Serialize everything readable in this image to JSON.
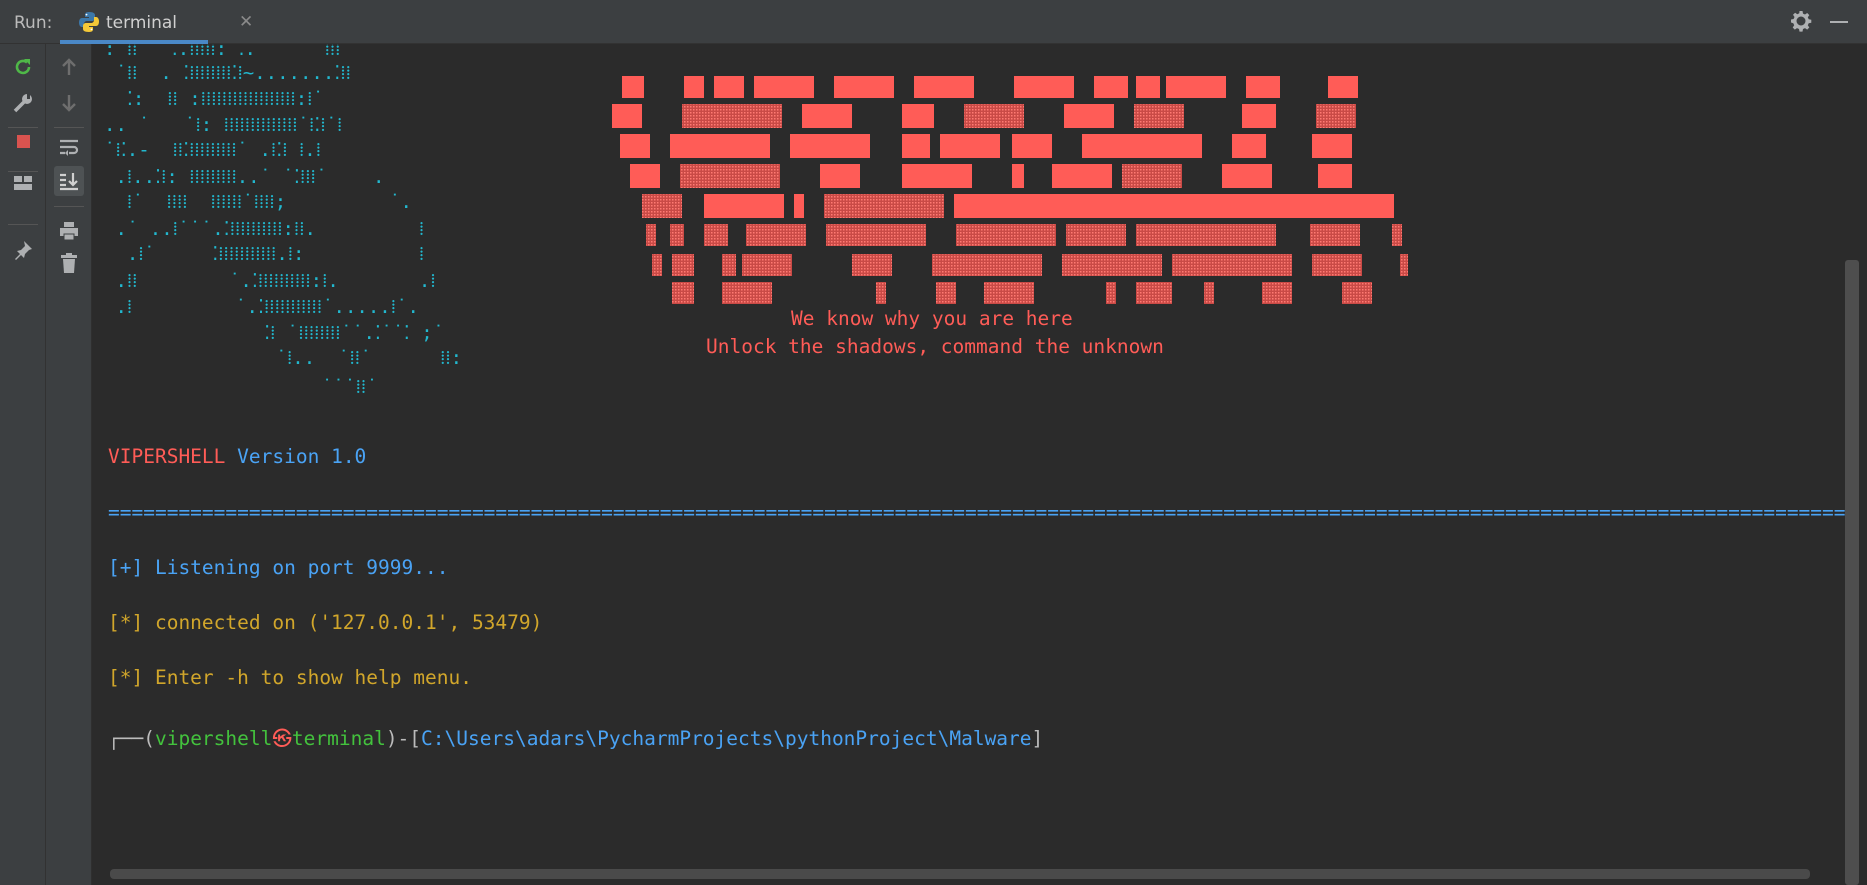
{
  "toolwindow": {
    "run_label": "Run:",
    "tab_label": "terminal",
    "tab_close": "✕",
    "icons": [
      "python-icon",
      "gear-icon",
      "minimize-icon"
    ]
  },
  "toolbar_left": [
    "rerun-icon",
    "wrench-icon",
    "stop-icon",
    "layout-icon",
    "pin-icon"
  ],
  "toolbar_right": [
    "up-arrow-icon",
    "down-arrow-icon",
    "soft-wrap-icon",
    "scroll-to-end-icon",
    "print-icon",
    "trash-icon"
  ],
  "console": {
    "tagline1": "We know why you are here",
    "tagline2": "Unlock the shadows, command the unknown",
    "product_name": "VIPERSHELL",
    "version_text": "Version 1.0",
    "divider": "======================================================================================================================================================",
    "listening": "[+] Listening on port 9999...",
    "connected": "[*] connected on ('127.0.0.1', 53479)",
    "help_hint": "[*] Enter -h to show help menu.",
    "prompt": {
      "corner": "┌──(",
      "user": "vipershell",
      "at": "㉿",
      "host": "terminal",
      "mid": ")-[",
      "path": "C:\\Users\\adars\\PycharmProjects\\pythonProject\\Malware",
      "end": "]"
    }
  },
  "colors": {
    "accent_red": "#ff5c57",
    "accent_blue": "#4aa3f5",
    "accent_yellow": "#d1a62b",
    "accent_green": "#43c23d",
    "art_cyan": "#22b8cf"
  }
}
